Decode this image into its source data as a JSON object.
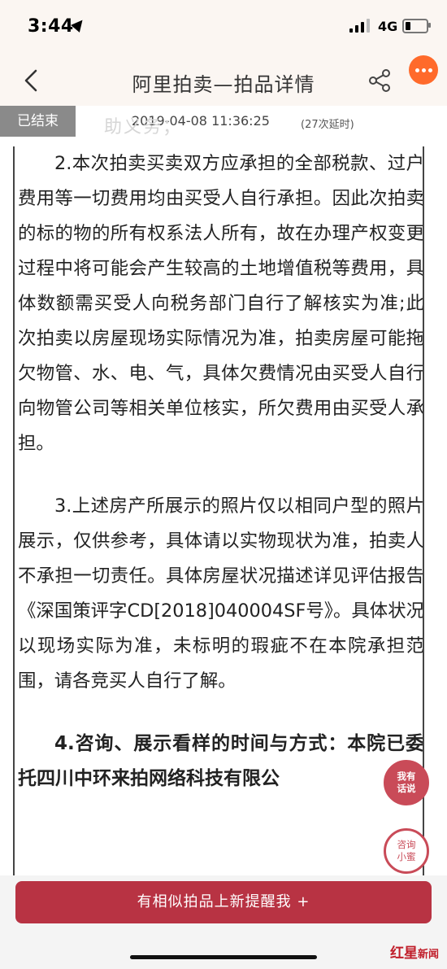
{
  "status": {
    "time": "3:44",
    "network": "4G"
  },
  "nav": {
    "title": "阿里拍卖—拍品详情"
  },
  "auction": {
    "status_tag": "已结束",
    "end_time": "2019-04-08 11:36:25",
    "delay": "(27次延时)",
    "ghost_text": "助义务；"
  },
  "content": {
    "para2": "2.本次拍卖买卖双方应承担的全部税款、过户费用等一切费用均由买受人自行承担。因此次拍卖的标的物的所有权系法人所有，故在办理产权变更过程中将可能会产生较高的土地增值税等费用，具体数额需买受人向税务部门自行了解核实为准;此次拍卖以房屋现场实际情况为准，拍卖房屋可能拖欠物管、水、电、气，具体欠费情况由买受人自行向物管公司等相关单位核实，所欠费用由买受人承担。",
    "para3": "3.上述房产所展示的照片仅以相同户型的照片展示，仅供参考，具体请以实物现状为准，拍卖人不承担一切责任。具体房屋状况描述详见评估报告《深国策评字CD[2018]040004SF号》。具体状况以现场实际为准，未标明的瑕疵不在本院承担范围，请各竞买人自行了解。",
    "para4": "4.咨询、展示看样的时间与方式：本院已委托四川中环来拍网络科技有限公"
  },
  "float": {
    "talk_line1": "我有",
    "talk_line2": "话说",
    "ask_line1": "咨询",
    "ask_line2": "小蜜"
  },
  "bottom": {
    "notify_label": "有相似拍品上新提醒我 +"
  },
  "watermark": {
    "brand_a": "红",
    "brand_b": "星",
    "brand_c": "新闻"
  },
  "icons": {
    "back": "chevron-left-icon",
    "share": "share-icon",
    "more": "more-dots-icon",
    "location": "location-arrow-icon",
    "signal": "signal-icon",
    "battery": "battery-icon"
  },
  "colors": {
    "accent": "#b83343",
    "more_button": "#ff6a2b",
    "ended_tag": "#8a8a8a",
    "header_bg": "#fbf6f2"
  }
}
